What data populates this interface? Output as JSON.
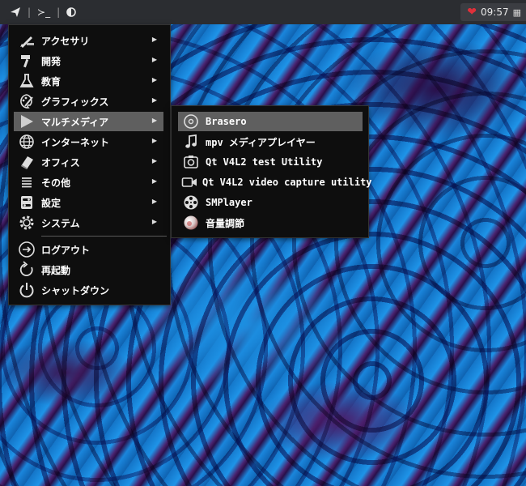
{
  "topbar": {
    "icons": [
      "send-icon",
      "terminal-icon",
      "night-mode-icon"
    ],
    "terminal_glyph": "≻_",
    "separator": "|",
    "clock": "09:57",
    "tray_icons": [
      "heart-icon",
      "calendar-icon"
    ]
  },
  "main_menu": {
    "items": [
      {
        "label": "アクセサリ",
        "icon": "pen-ruler-icon",
        "submenu": true
      },
      {
        "label": "開発",
        "icon": "hammer-icon",
        "submenu": true
      },
      {
        "label": "教育",
        "icon": "flask-icon",
        "submenu": true
      },
      {
        "label": "グラフィックス",
        "icon": "palette-icon",
        "submenu": true
      },
      {
        "label": "マルチメディア",
        "icon": "play-icon",
        "submenu": true,
        "active": true
      },
      {
        "label": "インターネット",
        "icon": "globe-icon",
        "submenu": true
      },
      {
        "label": "オフィス",
        "icon": "book-icon",
        "submenu": true
      },
      {
        "label": "その他",
        "icon": "list-icon",
        "submenu": true
      },
      {
        "label": "設定",
        "icon": "toggles-icon",
        "submenu": true
      },
      {
        "label": "システム",
        "icon": "gear-icon",
        "submenu": true
      }
    ],
    "session": [
      {
        "label": "ログアウト",
        "icon": "logout-icon"
      },
      {
        "label": "再起動",
        "icon": "restart-icon"
      },
      {
        "label": "シャットダウン",
        "icon": "power-icon"
      }
    ],
    "arrow": "▶"
  },
  "sub_menu": {
    "items": [
      {
        "label": "Brasero",
        "icon": "disc-icon",
        "active": true
      },
      {
        "label": "mpv メディアプレイヤー",
        "icon": "music-note-icon"
      },
      {
        "label": "Qt V4L2 test Utility",
        "icon": "webcam-icon"
      },
      {
        "label": "Qt V4L2 video capture utility",
        "icon": "video-camera-icon"
      },
      {
        "label": "SMPlayer",
        "icon": "film-reel-icon"
      },
      {
        "label": "音量調節",
        "icon": "volume-orb-icon"
      }
    ]
  },
  "colors": {
    "menu_bg": "#0e0e0e",
    "highlight": "#5f5f5f",
    "topbar_bg": "#2b2d31",
    "wallpaper_blue": "#1677cc",
    "wallpaper_purple": "#3a1a5a"
  }
}
